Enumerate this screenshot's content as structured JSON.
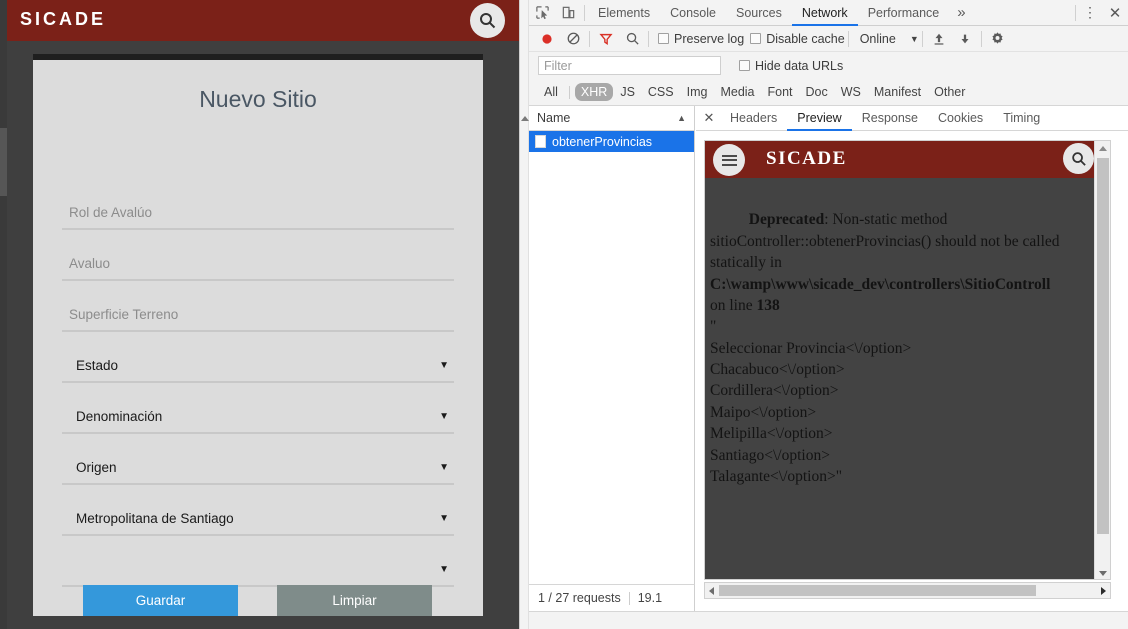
{
  "app": {
    "brand": "SICADE",
    "search_icon": "search-icon",
    "card": {
      "title": "Nuevo Sitio",
      "fields": [
        {
          "text": "Rol de Avalúo",
          "kind": "input",
          "name": "rol-de-avaluo"
        },
        {
          "text": "Avaluo",
          "kind": "input",
          "name": "avaluo"
        },
        {
          "text": "Superficie Terreno",
          "kind": "input",
          "name": "superficie-terreno"
        },
        {
          "text": "Estado",
          "kind": "select",
          "name": "estado"
        },
        {
          "text": "Denominación",
          "kind": "select",
          "name": "denominacion"
        },
        {
          "text": "Origen",
          "kind": "select",
          "name": "origen"
        },
        {
          "text": "Metropolitana de Santiago",
          "kind": "select",
          "name": "region"
        },
        {
          "text": "",
          "kind": "select",
          "name": "provincia"
        }
      ],
      "save_label": "Guardar",
      "clear_label": "Limpiar"
    }
  },
  "devtools": {
    "panel_tabs": [
      {
        "label": "Elements",
        "active": false
      },
      {
        "label": "Console",
        "active": false
      },
      {
        "label": "Sources",
        "active": false
      },
      {
        "label": "Network",
        "active": true
      },
      {
        "label": "Performance",
        "active": false
      }
    ],
    "more_tabs_glyph": "»",
    "kebab_glyph": "⋮",
    "close_glyph": "✕",
    "toolbar": {
      "record_icon": "record-icon",
      "clear_icon": "clear-icon",
      "filter_icon": "filter-icon",
      "search_icon": "search-icon",
      "preserve_log_label": "Preserve log",
      "preserve_log_checked": false,
      "disable_cache_label": "Disable cache",
      "disable_cache_checked": false,
      "throttling_value": "Online",
      "import_icon": "import-icon",
      "export_icon": "export-icon",
      "settings_icon": "gear-icon"
    },
    "filter": {
      "value": "",
      "placeholder": "Filter",
      "hide_data_urls_label": "Hide data URLs",
      "hide_data_urls_checked": false
    },
    "resource_types": [
      {
        "label": "All",
        "active": false
      },
      {
        "label": "XHR",
        "active": true
      },
      {
        "label": "JS",
        "active": false
      },
      {
        "label": "CSS",
        "active": false
      },
      {
        "label": "Img",
        "active": false
      },
      {
        "label": "Media",
        "active": false
      },
      {
        "label": "Font",
        "active": false
      },
      {
        "label": "Doc",
        "active": false
      },
      {
        "label": "WS",
        "active": false
      },
      {
        "label": "Manifest",
        "active": false
      },
      {
        "label": "Other",
        "active": false
      }
    ],
    "request_list": {
      "column_header": "Name",
      "sort_glyph": "▲",
      "rows": [
        {
          "name": "obtenerProvincias",
          "selected": true
        }
      ]
    },
    "detail_tabs": [
      {
        "label": "Headers",
        "active": false
      },
      {
        "label": "Preview",
        "active": true
      },
      {
        "label": "Response",
        "active": false
      },
      {
        "label": "Cookies",
        "active": false
      },
      {
        "label": "Timing",
        "active": false
      }
    ],
    "status": {
      "requests": "1 / 27 requests",
      "transferred": "19.1"
    }
  },
  "preview": {
    "brand": "SICADE",
    "menu_icon": "hamburger-icon",
    "search_icon": "search-icon",
    "warning_label": "Deprecated",
    "warning_rest": ": Non-static method sitioController::obtenerProvincias() should not be called statically in ",
    "warning_path": "C:\\wamp\\www\\sicade_dev\\controllers\\SitioControll",
    "warning_line_prefix": "on line ",
    "warning_line": "138",
    "quote_open": "\"",
    "options": [
      "Seleccionar Provincia<\\/option>",
      "Chacabuco<\\/option>",
      "Cordillera<\\/option>",
      "Maipo<\\/option>",
      "Melipilla<\\/option>",
      "Santiago<\\/option>",
      "Talagante<\\/option>\""
    ]
  }
}
